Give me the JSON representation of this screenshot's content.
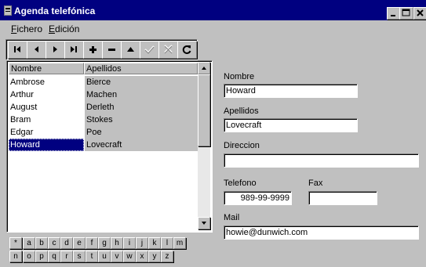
{
  "window": {
    "title": "Agenda telefónica"
  },
  "menu": {
    "items": [
      {
        "label": "Fichero"
      },
      {
        "label": "Edición"
      }
    ]
  },
  "grid": {
    "columns": [
      "Nombre",
      "Apellidos"
    ],
    "rows": [
      {
        "nombre": "Ambrose",
        "apellidos": "Bierce"
      },
      {
        "nombre": "Arthur",
        "apellidos": "Machen"
      },
      {
        "nombre": "August",
        "apellidos": "Derleth"
      },
      {
        "nombre": "Bram",
        "apellidos": "Stokes"
      },
      {
        "nombre": "Edgar",
        "apellidos": "Poe"
      },
      {
        "nombre": "Howard",
        "apellidos": "Lovecraft"
      }
    ],
    "selected_row": "Howard"
  },
  "alphabet": {
    "row1": [
      "*",
      "a",
      "b",
      "c",
      "d",
      "e",
      "f",
      "g",
      "h",
      "i",
      "j",
      "k",
      "l",
      "m"
    ],
    "row2": [
      "n",
      "o",
      "p",
      "q",
      "r",
      "s",
      "t",
      "u",
      "v",
      "w",
      "x",
      "y",
      "z"
    ]
  },
  "form": {
    "nombre_label": "Nombre",
    "nombre_value": "Howard",
    "apellidos_label": "Apellidos",
    "apellidos_value": "Lovecraft",
    "direccion_label": "Direccion",
    "direccion_value": "",
    "telefono_label": "Telefono",
    "telefono_value": "989-99-9999",
    "fax_label": "Fax",
    "fax_value": "",
    "mail_label": "Mail",
    "mail_value": "howie@dunwich.com"
  },
  "toolbar": {
    "buttons": [
      "first-record",
      "prior-record",
      "next-record",
      "last-record",
      "insert-record",
      "delete-record",
      "edit-record",
      "post-record",
      "cancel-record",
      "refresh-records"
    ]
  },
  "colors": {
    "titlebar": "#000080",
    "face": "#c0c0c0",
    "selection": "#000080"
  }
}
